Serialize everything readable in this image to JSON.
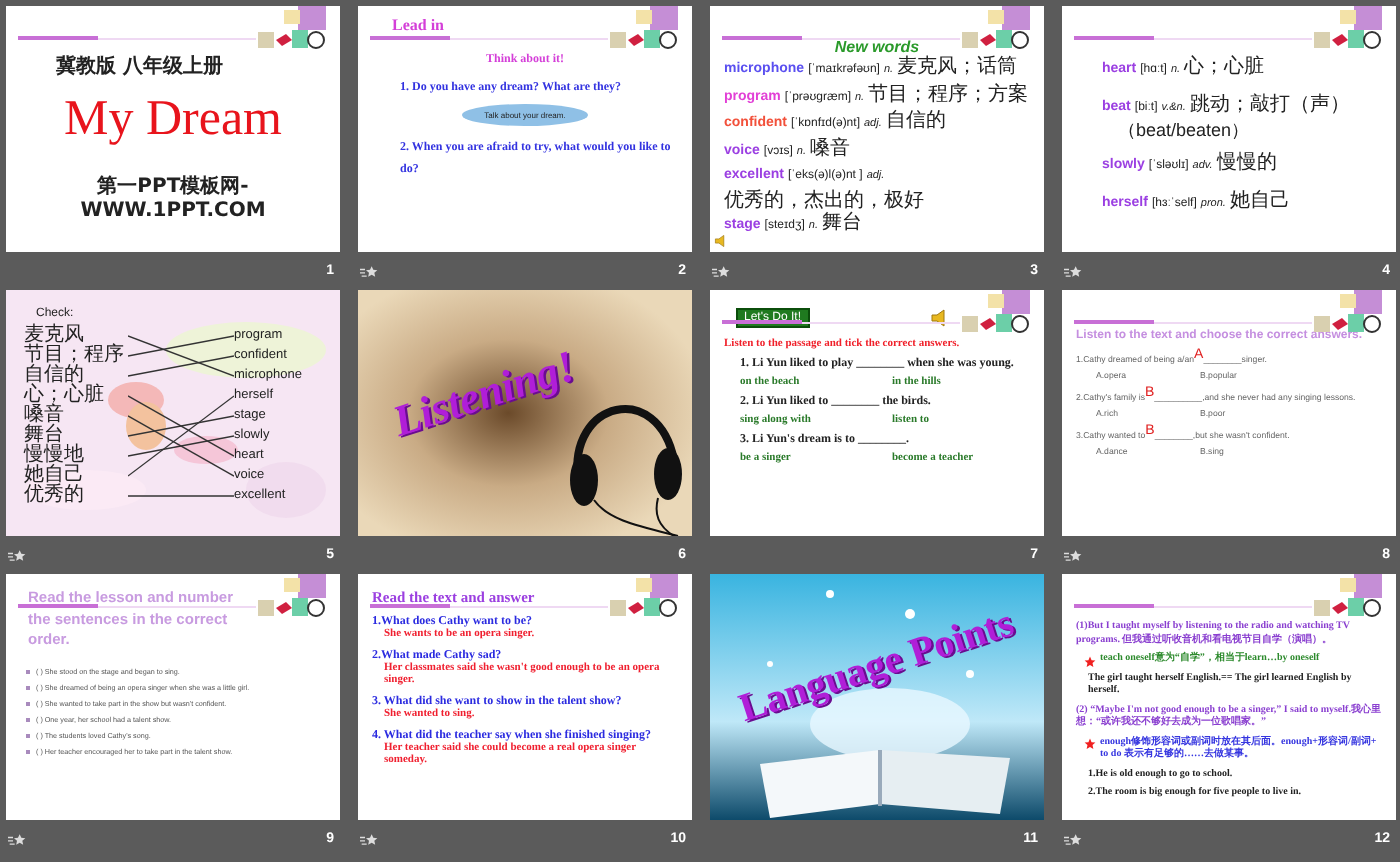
{
  "slides": [
    {
      "number": "1",
      "animated": false,
      "kind": "title",
      "subtitle": "冀教版 八年级上册",
      "title": "My Dream",
      "footer": "第一PPT模板网-WWW.1PPT.COM"
    },
    {
      "number": "2",
      "animated": true,
      "kind": "lead_in",
      "heading": "Lead in",
      "prompt": "Think about it!",
      "questions": [
        "1. Do you have any dream? What are they?",
        "2. When you are afraid to try, what would you like to do?"
      ],
      "bubble": "Talk about your dream."
    },
    {
      "number": "3",
      "animated": true,
      "kind": "vocab",
      "heading": "New words",
      "sound": true,
      "entries": [
        {
          "word": "microphone",
          "color": "#5a4ff0",
          "phonetic": "[ˈmaɪkrəfəʊn]",
          "pos": "n.",
          "meaning": "麦克风；话筒"
        },
        {
          "word": "program",
          "color": "#e23fd6",
          "phonetic": "[ˈprəʊɡræm]",
          "pos": "n.",
          "meaning": "节目；程序；方案"
        },
        {
          "word": "confident",
          "color": "#f2503a",
          "phonetic": "[ˈkɒnfɪd(ə)nt]",
          "pos": "adj.",
          "meaning": "自信的"
        },
        {
          "word": "voice",
          "color": "#9b3fe2",
          "phonetic": "[vɔɪs]",
          "pos": "n.",
          "meaning": "嗓音"
        },
        {
          "word": "excellent",
          "color": "#9b3fe2",
          "phonetic": "[ˈeks(ə)l(ə)nt ]",
          "pos": "adj.",
          "meaning": "优秀的，杰出的，极好"
        },
        {
          "word": "stage",
          "color": "#9b3fe2",
          "phonetic": "[steɪdʒ]",
          "pos": "n.",
          "meaning": "舞台"
        }
      ]
    },
    {
      "number": "4",
      "animated": true,
      "kind": "vocab",
      "entries": [
        {
          "word": "heart",
          "color": "#9b3fe2",
          "phonetic": "[hɑːt]",
          "pos": "n.",
          "meaning": "心；心脏"
        },
        {
          "word": "beat",
          "color": "#9b3fe2",
          "phonetic": "[biːt]",
          "pos": "v.&n.",
          "meaning": "跳动；敲打（声）",
          "note": "（beat/beaten）"
        },
        {
          "word": "slowly",
          "color": "#9b3fe2",
          "phonetic": "[ˈsləʊlɪ]",
          "pos": "adv.",
          "meaning": "慢慢的"
        },
        {
          "word": "herself",
          "color": "#9b3fe2",
          "phonetic": "[hɜːˈself]",
          "pos": "pron.",
          "meaning": "她自己"
        }
      ]
    },
    {
      "number": "5",
      "animated": true,
      "kind": "matching",
      "heading": "Check:",
      "left": [
        "麦克风",
        "节目；程序",
        "自信的",
        "心；心脏",
        "嗓音",
        "舞台",
        "慢慢地",
        "她自己",
        "优秀的"
      ],
      "right": [
        "program",
        "confident",
        "microphone",
        "herself",
        "stage",
        "slowly",
        "heart",
        "voice",
        "excellent"
      ]
    },
    {
      "number": "6",
      "animated": false,
      "kind": "cover",
      "title": "Listening!"
    },
    {
      "number": "7",
      "animated": false,
      "kind": "exercise",
      "badge": "Let's Do It!",
      "sound": true,
      "instruction": "Listen to the passage and tick the correct answers.",
      "questions": [
        {
          "text": "1. Li Yun liked to play ________ when she was young.",
          "options": [
            "on the beach",
            "in the hills"
          ]
        },
        {
          "text": "2. Li Yun liked to ________ the birds.",
          "options": [
            "sing along with",
            "listen to"
          ]
        },
        {
          "text": "3. Li Yun's dream is to ________.",
          "options": [
            "be a singer",
            "become a teacher"
          ]
        }
      ]
    },
    {
      "number": "8",
      "animated": true,
      "kind": "choices",
      "heading": "Listen to the text and choose the correct answers.",
      "items": [
        {
          "prompt": "1.Cathy dreamed of being a/an",
          "answer": "A",
          "rest": "________singer.",
          "options": [
            "A.opera",
            "B.popular"
          ]
        },
        {
          "prompt": "2.Cathy's family is",
          "answer": "B",
          "rest": "__________,and she never had any singing lessons.",
          "options": [
            "A.rich",
            "B.poor"
          ]
        },
        {
          "prompt": "3.Cathy wanted to",
          "answer": "B",
          "rest": "________,but she wasn't confident.",
          "options": [
            "A.dance",
            "B.sing"
          ]
        }
      ]
    },
    {
      "number": "9",
      "animated": true,
      "kind": "ordering",
      "heading": "Read the lesson  and number the sentences  in the correct order.",
      "items": [
        "( ) She stood on the stage and began to sing.",
        "( ) She dreamed of being an opera singer when she was a little girl.",
        "( ) She wanted to take part in the show but wasn't confident.",
        "( ) One year, her school had a talent show.",
        "( ) The students loved Cathy's song.",
        "( ) Her teacher encouraged her to take part in the talent show."
      ]
    },
    {
      "number": "10",
      "animated": true,
      "kind": "qa",
      "heading": "Read the text and answer",
      "items": [
        {
          "question": "1.What does Cathy want to be?",
          "answer": "She wants to be an opera singer."
        },
        {
          "question": "2.What made Cathy sad?",
          "answer": "Her classmates said she wasn't good enough to be an opera singer."
        },
        {
          "question": "3. What did she want to show in the talent show?",
          "answer": "She wanted  to sing."
        },
        {
          "question": "4. What did the teacher say when she finished singing?",
          "answer": "Her teacher said she could become a real opera singer someday."
        }
      ]
    },
    {
      "number": "11",
      "animated": false,
      "kind": "cover",
      "title": "Language Points"
    },
    {
      "number": "12",
      "animated": true,
      "kind": "notes",
      "paragraphs": [
        {
          "kind": "quote",
          "text": "(1)But I taught myself by listening to the radio and watching TV programs. 但我通过听收音机和看电视节目自学（演唱）。"
        },
        {
          "kind": "tip",
          "text": "teach oneself意为“自学”，相当于learn…by oneself"
        },
        {
          "kind": "plain",
          "text": "The girl taught herself English.== The girl learned English by herself."
        },
        {
          "kind": "quote",
          "text": "(2) “Maybe I'm not good enough to be a singer,” I said to myself.我心里想：“或许我还不够好去成为一位歌唱家。”"
        },
        {
          "kind": "rule",
          "text": "enough修饰形容词或副词时放在其后面。enough+形容词/副词+ to do 表示有足够的……去做某事。"
        },
        {
          "kind": "plain",
          "text": "1.He is old enough to go to school."
        },
        {
          "kind": "plain",
          "text": "2.The room is big enough for five people to live in."
        }
      ]
    }
  ]
}
